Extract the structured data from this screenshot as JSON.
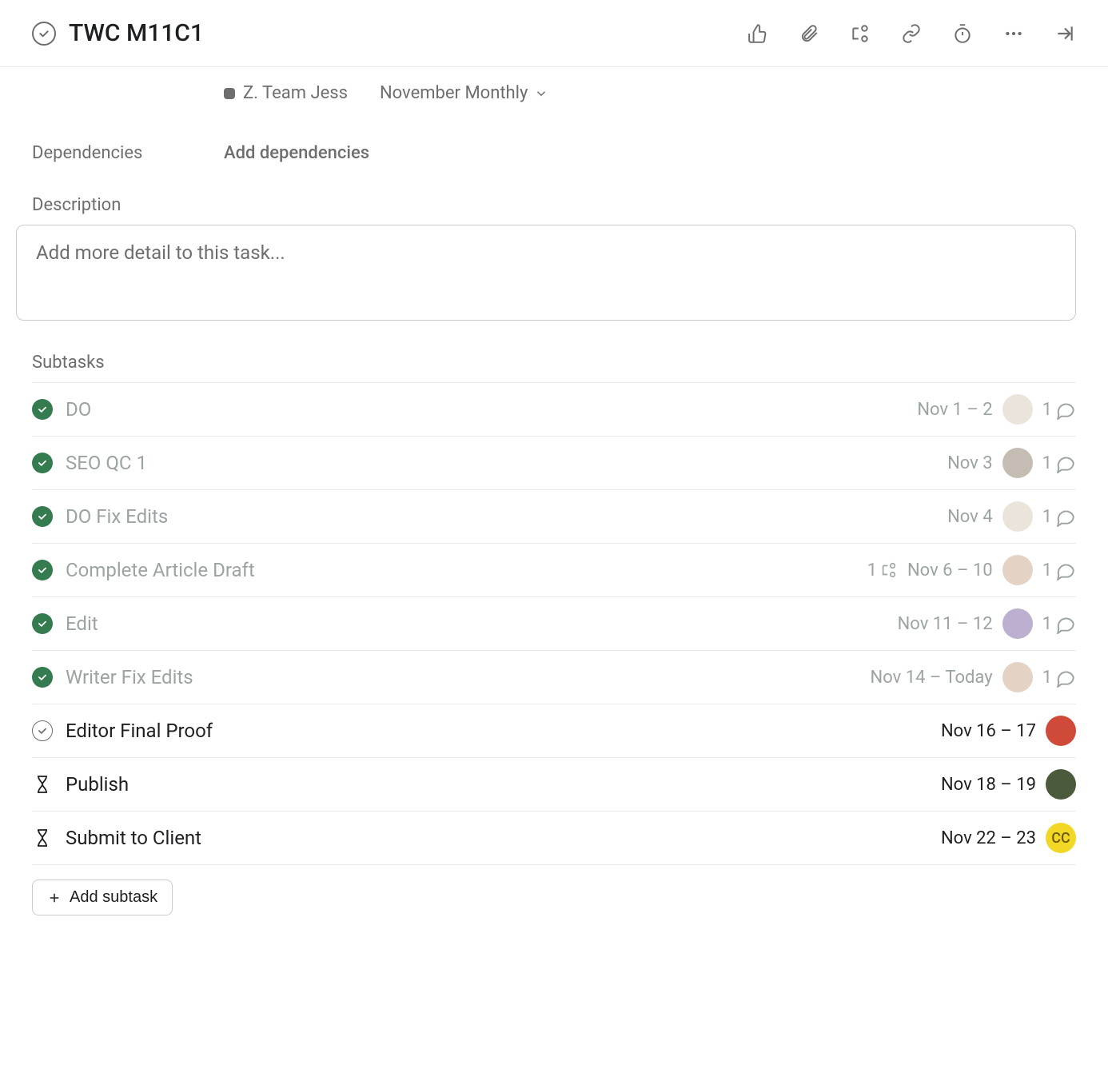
{
  "header": {
    "title": "TWC M11C1"
  },
  "project": {
    "name": "Z. Team Jess",
    "section": "November Monthly"
  },
  "fields": {
    "dependencies_label": "Dependencies",
    "dependencies_action": "Add dependencies",
    "description_label": "Description",
    "description_placeholder": "Add more detail to this task..."
  },
  "subtasks_label": "Subtasks",
  "subtasks": [
    {
      "name": "DO",
      "status": "done",
      "date": "Nov 1 – 2",
      "avatar_color": "#d8c9b6",
      "comments": 1
    },
    {
      "name": "SEO QC 1",
      "status": "done",
      "date": "Nov 3",
      "avatar_color": "#8b7a6a",
      "comments": 1
    },
    {
      "name": "DO Fix Edits",
      "status": "done",
      "date": "Nov 4",
      "avatar_color": "#d8c9b6",
      "comments": 1
    },
    {
      "name": "Complete Article Draft",
      "status": "done",
      "date": "Nov 6 – 10",
      "avatar_color": "#c9a68a",
      "comments": 1,
      "sub_count": 1
    },
    {
      "name": "Edit",
      "status": "done",
      "date": "Nov 11 – 12",
      "avatar_color": "#7a5fa0",
      "comments": 1
    },
    {
      "name": "Writer Fix Edits",
      "status": "done",
      "date": "Nov 14 – Today",
      "avatar_color": "#c9a68a",
      "comments": 1
    },
    {
      "name": "Editor Final Proof",
      "status": "open",
      "date": "Nov 16 – 17",
      "avatar_color": "#d04a3a"
    },
    {
      "name": "Publish",
      "status": "waiting",
      "date": "Nov 18 – 19",
      "avatar_color": "#4a5a3a"
    },
    {
      "name": "Submit to Client",
      "status": "waiting",
      "date": "Nov 22 – 23",
      "avatar_initials": "CC"
    }
  ],
  "add_subtask_label": "Add subtask"
}
